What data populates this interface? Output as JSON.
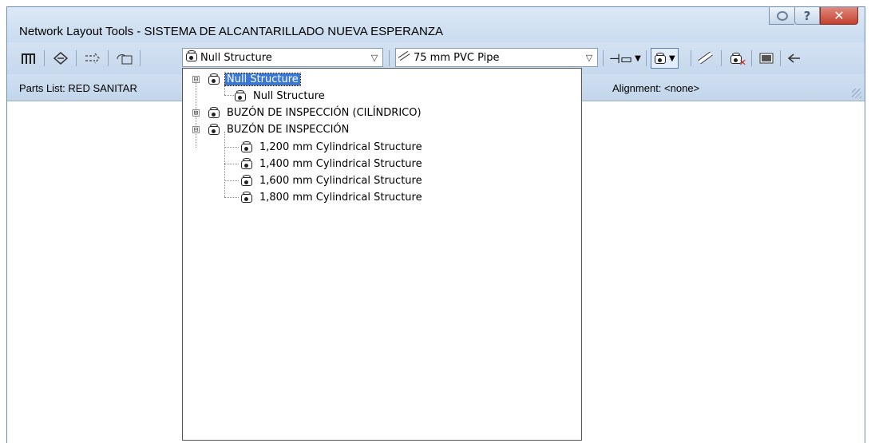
{
  "window": {
    "title": "Network Layout Tools - SISTEMA DE ALCANTARILLADO NUEVA ESPERANZA",
    "help_label": "?",
    "close_label": "✕"
  },
  "toolbar": {
    "structure_combo": {
      "value": "Null Structure",
      "icon": "structure-icon"
    },
    "pipe_combo": {
      "value": "75 mm PVC Pipe",
      "icon": "pipe-icon"
    }
  },
  "status": {
    "parts_list": "Parts List: RED SANITAR",
    "alignment": "Alignment: <none>"
  },
  "tree": [
    {
      "label": "Null Structure",
      "level": 0,
      "expander": "⊟",
      "selected": true
    },
    {
      "label": "Null Structure",
      "level": 1
    },
    {
      "label": "BUZÓN DE INSPECCIÓN (CILÍNDRICO)",
      "level": 0,
      "expander": "⊞"
    },
    {
      "label": "BUZÓN DE INSPECCIÓN",
      "level": 0,
      "expander": "⊟"
    },
    {
      "label": "1,200 mm Cylindrical Structure",
      "level": 1
    },
    {
      "label": "1,400 mm Cylindrical Structure",
      "level": 1
    },
    {
      "label": "1,600 mm Cylindrical Structure",
      "level": 1
    },
    {
      "label": "1,800 mm Cylindrical Structure",
      "level": 1
    }
  ],
  "colors": {
    "selection": "#3a78d4",
    "titlebar": "#dce9f7",
    "close_button": "#c2412f"
  }
}
